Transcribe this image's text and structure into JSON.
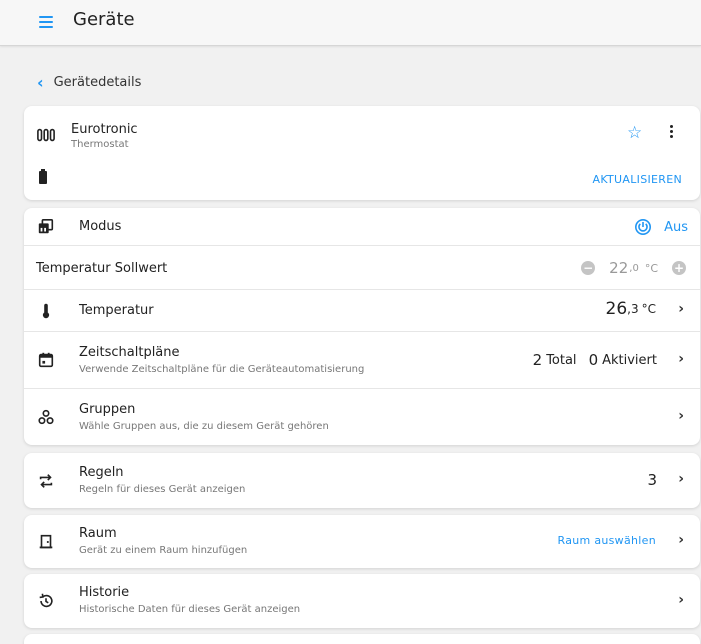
{
  "appbar": {
    "title": "Geräte",
    "menu_icon": "menu-icon"
  },
  "nav": {
    "back_label": "Gerätedetails"
  },
  "device": {
    "name": "Eurotronic",
    "type": "Thermostat",
    "update_label": "AKTUALISIEREN"
  },
  "rows": {
    "modus": {
      "label": "Modus",
      "value": "Aus"
    },
    "sollwert": {
      "label": "Temperatur Sollwert",
      "value_int": "22",
      "value_dec": ",0",
      "unit": "°C",
      "minus": "−",
      "plus": "+"
    },
    "temperatur": {
      "label": "Temperatur",
      "value_int": "26",
      "value_dec": ",3",
      "unit": "°C"
    },
    "zeitschalt": {
      "label": "Zeitschaltpläne",
      "sub": "Verwende Zeitschaltpläne für die Geräteautomatisierung",
      "total_num": "2",
      "total_label": "Total",
      "active_num": "0",
      "active_label": "Aktiviert"
    },
    "gruppen": {
      "label": "Gruppen",
      "sub": "Wähle Gruppen aus, die zu diesem Gerät gehören"
    },
    "regeln": {
      "label": "Regeln",
      "sub": "Regeln für dieses Gerät anzeigen",
      "count": "3"
    },
    "raum": {
      "label": "Raum",
      "sub": "Gerät zu einem Raum hinzufügen",
      "action": "Raum auswählen"
    },
    "historie": {
      "label": "Historie",
      "sub": "Historische Daten für dieses Gerät anzeigen"
    }
  },
  "chevron": "›",
  "colors": {
    "accent": "#2196f3"
  }
}
